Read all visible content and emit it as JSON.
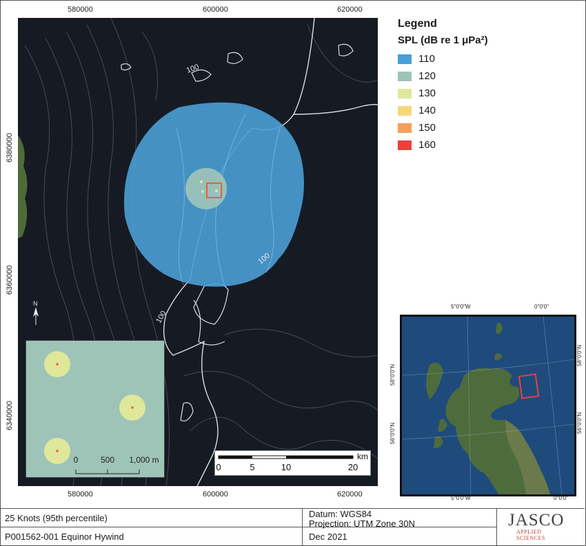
{
  "map_axes": {
    "x_ticks": [
      "580000",
      "600000",
      "620000"
    ],
    "y_ticks": [
      "6380000",
      "6360000",
      "6340000"
    ],
    "contour_label": "100"
  },
  "legend": {
    "title": "Legend",
    "subtitle": "SPL (dB re 1 μPa²)",
    "items": [
      {
        "label": "110",
        "color": "#4a9fd6"
      },
      {
        "label": "120",
        "color": "#9ec4b8"
      },
      {
        "label": "130",
        "color": "#dfe89a"
      },
      {
        "label": "140",
        "color": "#f6d87a"
      },
      {
        "label": "150",
        "color": "#f5a05a"
      },
      {
        "label": "160",
        "color": "#e8423c"
      }
    ]
  },
  "inset_scale": {
    "labels": [
      "0",
      "500",
      "1,000 m"
    ]
  },
  "scalebar": {
    "unit": "km",
    "labels": [
      "0",
      "5",
      "10",
      "20"
    ]
  },
  "north_arrow": "N",
  "locator": {
    "top_labels": [
      "5°0'0\"W",
      "0°0'0\""
    ],
    "bottom_labels": [
      "5°0'0\"W",
      "0°0'0\""
    ],
    "left_labels": [
      "58°0'0\"N",
      "56°0'0\"N"
    ],
    "right_labels": [
      "58°0'0\"N",
      "56°0'0\"N"
    ]
  },
  "footer": {
    "scenario": "25 Knots (95th percentile)",
    "project": "P001562-001 Equinor Hywind",
    "datum": "Datum: WGS84",
    "projection": "Projection: UTM Zone 30N",
    "date": "Dec 2021",
    "logo_main": "JASCO",
    "logo_sub": "APPLIED SCIENCES"
  }
}
